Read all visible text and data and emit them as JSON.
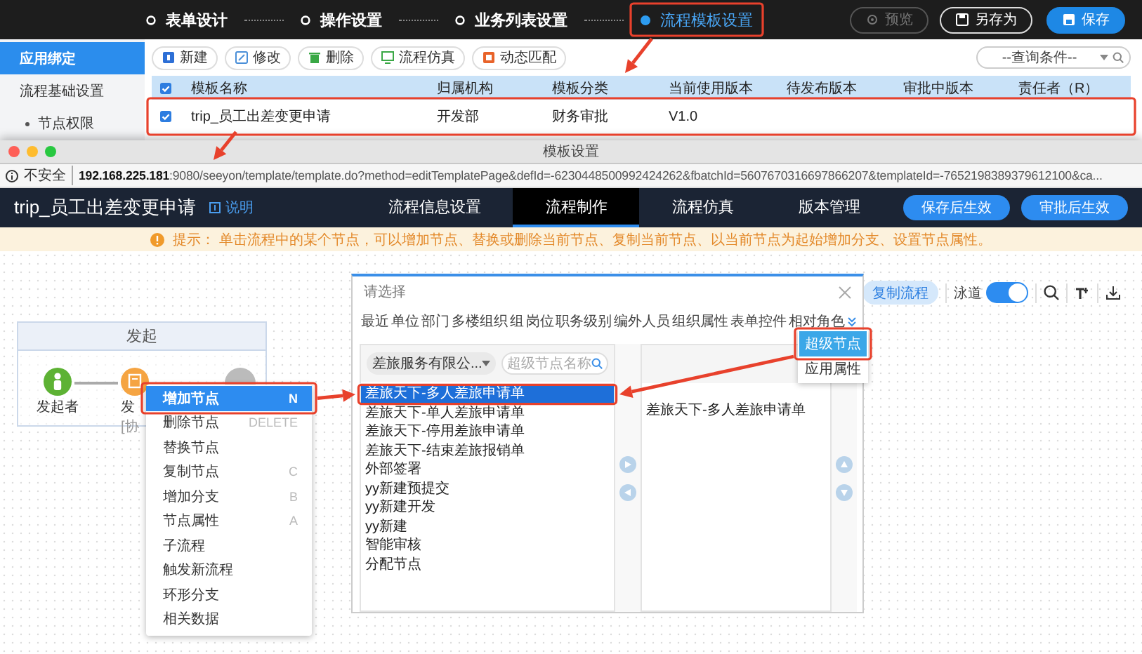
{
  "main_window": {
    "steps": [
      {
        "label": "表单设计",
        "selected": false
      },
      {
        "label": "操作设置",
        "selected": false
      },
      {
        "label": "业务列表设置",
        "selected": false
      },
      {
        "label": "流程模板设置",
        "selected": true
      }
    ],
    "actions": [
      {
        "label": "预览",
        "kind": "disabled"
      },
      {
        "label": "另存为",
        "kind": "outline"
      },
      {
        "label": "保存",
        "kind": "primary"
      }
    ],
    "sidebar": {
      "items": [
        {
          "label": "应用绑定",
          "selected": true,
          "kind": "group"
        },
        {
          "label": "流程基础设置",
          "selected": false,
          "kind": "group"
        },
        {
          "label": "节点权限",
          "selected": false,
          "kind": "sub"
        }
      ]
    },
    "toolbar": {
      "buttons": [
        {
          "label": "新建",
          "kind": "new"
        },
        {
          "label": "修改",
          "kind": "edit"
        },
        {
          "label": "删除",
          "kind": "delete"
        },
        {
          "label": "流程仿真",
          "kind": "simulate"
        },
        {
          "label": "动态匹配",
          "kind": "match"
        }
      ],
      "query": {
        "value": "--查询条件--"
      }
    },
    "table": {
      "all_checked": true,
      "columns": [
        "模板名称",
        "归属机构",
        "模板分类",
        "当前使用版本",
        "待发布版本",
        "审批中版本",
        "责任者（R）"
      ],
      "rows": [
        {
          "checked": true,
          "cells": [
            "trip_员工出差变更申请",
            "开发部",
            "财务审批",
            "V1.0"
          ]
        }
      ]
    }
  },
  "template_window": {
    "title": "模板设置",
    "address": {
      "security": "不安全",
      "url": "**192.168.225.181**:9080/seeyon/template/template.do?method=editTemplatePage&defId=-6230448500992424262&fbatchId=5607670316697866207&templateId=-7652198389379612100&ca..."
    },
    "header": {
      "title": "trip_员工出差变更申请",
      "help_link": "说明",
      "tabs": [
        {
          "label": "流程信息设置",
          "selected": false
        },
        {
          "label": "流程制作",
          "selected": true
        },
        {
          "label": "流程仿真",
          "selected": false
        },
        {
          "label": "版本管理",
          "selected": false
        }
      ],
      "buttons": [
        "保存后生效",
        "审批后生效"
      ]
    },
    "hint": "提示： 单击流程中的某个节点，可以增加节点、替换或删除当前节点、复制当前节点、以当前节点为起始增加分支、设置节点属性。",
    "canvas": {
      "toolbar": {
        "copy_button": "复制流程",
        "swimlane": {
          "label": "泳道",
          "on": true
        }
      },
      "lane": {
        "title": "发起",
        "nodes": [
          {
            "kind": "start",
            "label": "发起者"
          },
          {
            "kind": "task",
            "label": "发",
            "sublabel": "[协"
          },
          {
            "kind": "end"
          }
        ]
      },
      "context_menu": {
        "items": [
          {
            "label": "增加节点",
            "shortcut": "N",
            "selected": true
          },
          {
            "label": "删除节点",
            "shortcut": "DELETE",
            "selected": false
          },
          {
            "label": "替换节点",
            "selected": false
          },
          {
            "label": "复制节点",
            "shortcut": "C",
            "selected": false
          },
          {
            "label": "增加分支",
            "shortcut": "B",
            "selected": false
          },
          {
            "label": "节点属性",
            "shortcut": "A",
            "selected": false
          },
          {
            "label": "子流程",
            "selected": false
          },
          {
            "label": "触发新流程",
            "selected": false
          },
          {
            "label": "环形分支",
            "selected": false
          },
          {
            "label": "相关数据",
            "selected": false
          }
        ]
      },
      "dialog": {
        "title": "请选择",
        "tabs": [
          "最近",
          "单位",
          "部门",
          "多楼组织",
          "组",
          "岗位",
          "职务级别",
          "编外人员",
          "组织属性",
          "表单控件",
          "相对角色"
        ],
        "org_select": {
          "value": "差旅服务有限公..."
        },
        "search": {
          "placeholder": "超级节点名称"
        },
        "available": [
          {
            "label": "差旅天下-多人差旅申请单",
            "selected": true
          },
          {
            "label": "差旅天下-单人差旅申请单",
            "selected": false
          },
          {
            "label": "差旅天下-停用差旅申请单",
            "selected": false
          },
          {
            "label": "差旅天下-结束差旅报销单",
            "selected": false
          },
          {
            "label": "外部签署",
            "selected": false
          },
          {
            "label": "yy新建预提交",
            "selected": false
          },
          {
            "label": "yy新建开发",
            "selected": false
          },
          {
            "label": "yy新建",
            "selected": false
          },
          {
            "label": "智能审核",
            "selected": false
          },
          {
            "label": "分配节点",
            "selected": false
          }
        ],
        "chosen": [
          "差旅天下-多人差旅申请单"
        ],
        "side_buttons": [
          {
            "label": "超级节点",
            "selected": true
          },
          {
            "label": "应用属性",
            "selected": false
          }
        ]
      }
    }
  }
}
